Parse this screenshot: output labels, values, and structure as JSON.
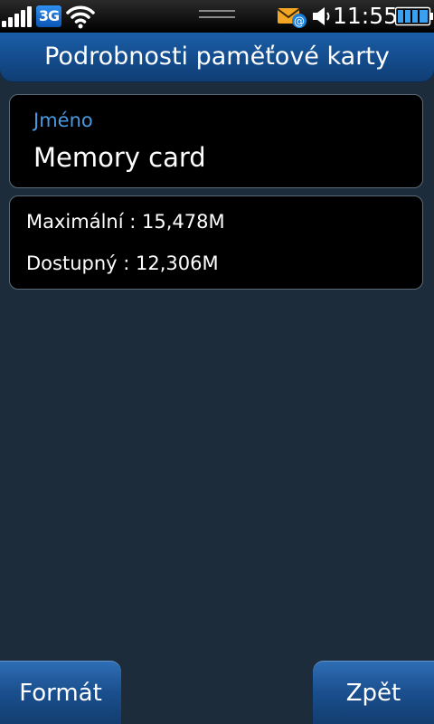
{
  "status_bar": {
    "network_type": "3G",
    "time": "11:55",
    "icons": [
      "signal-icon",
      "3g-icon",
      "wifi-icon",
      "notification-handle-icon",
      "email-icon",
      "volume-icon",
      "battery-icon"
    ]
  },
  "header": {
    "title": "Podrobnosti paměťové karty"
  },
  "name_section": {
    "label": "Jméno",
    "value": "Memory card"
  },
  "info_section": {
    "maximum": "Maximální : 15,478M",
    "available": "Dostupný : 12,306M"
  },
  "buttons": {
    "format": "Formát",
    "back": "Zpět"
  },
  "colors": {
    "background": "#1c2c3b",
    "accent_label": "#4a98e0",
    "title_bar": "#144c8c"
  }
}
